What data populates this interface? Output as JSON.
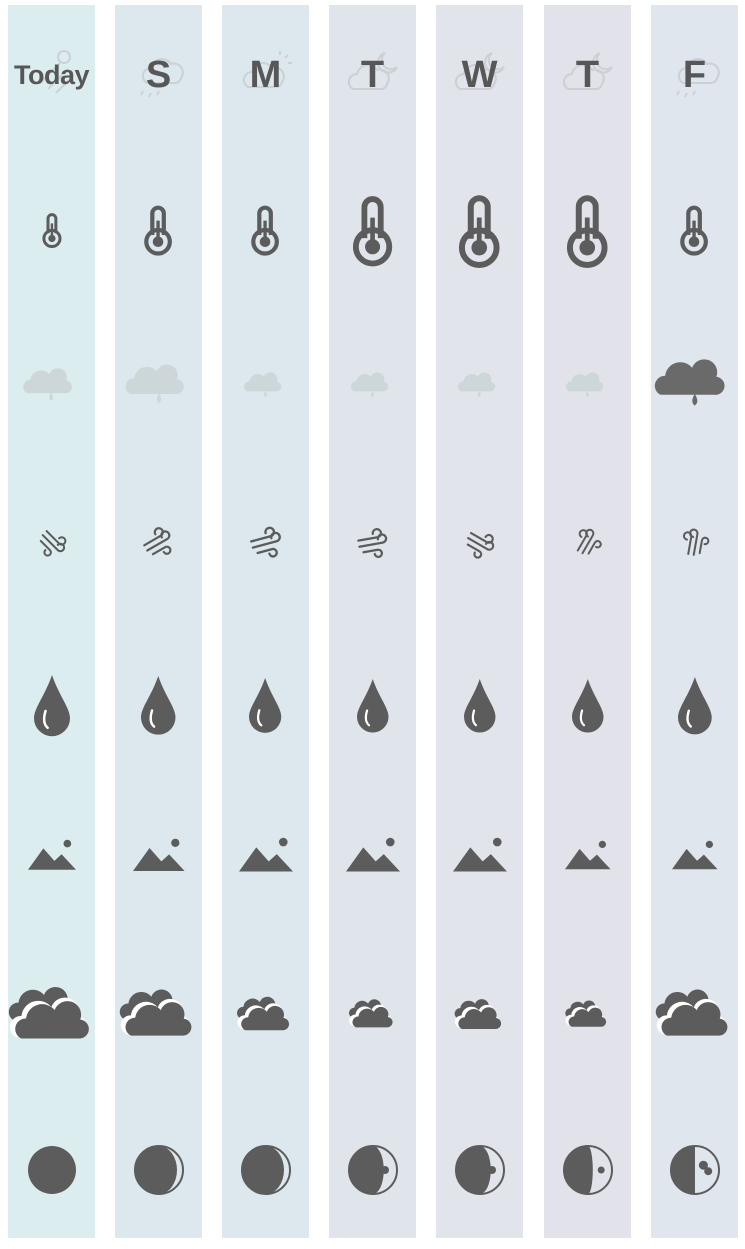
{
  "colors": {
    "icon": "#5c5c5c",
    "rain_faint": "#cdd6d9",
    "rain_dark": "#6a6a6a"
  },
  "days": [
    {
      "label": "Today",
      "bg": "#dcedef",
      "header_icon": "sun-rain-icon",
      "temp": 0.25,
      "rain": 0.55,
      "rain_dark": false,
      "wind": 0.65,
      "wind_dir": 45,
      "humidity": 1.0,
      "visibility": 0.75,
      "clouds": 1.0,
      "moon": "full-moon-icon"
    },
    {
      "label": "S",
      "bg": "#dce8ed",
      "header_icon": "cloud-rain-icon",
      "temp": 0.55,
      "rain": 0.75,
      "rain_dark": false,
      "wind": 0.85,
      "wind_dir": -30,
      "humidity": 0.9,
      "visibility": 0.9,
      "clouds": 0.85,
      "moon": "waning-gibbous-icon"
    },
    {
      "label": "M",
      "bg": "#dce8ed",
      "header_icon": "cloud-sun-icon",
      "temp": 0.55,
      "rain": 0.3,
      "rain_dark": false,
      "wind": 1.0,
      "wind_dir": -15,
      "humidity": 0.75,
      "visibility": 1.0,
      "clouds": 0.5,
      "moon": "waning-gibbous-icon"
    },
    {
      "label": "T",
      "bg": "#e0e4eb",
      "header_icon": "cloud-moon-icon",
      "temp": 0.95,
      "rain": 0.3,
      "rain_dark": false,
      "wind": 0.9,
      "wind_dir": -10,
      "humidity": 0.7,
      "visibility": 1.0,
      "clouds": 0.35,
      "moon": "last-quarter-icon"
    },
    {
      "label": "W",
      "bg": "#e2e4eb",
      "header_icon": "cloud-moon-icon",
      "temp": 1.0,
      "rain": 0.3,
      "rain_dark": false,
      "wind": 0.75,
      "wind_dir": 30,
      "humidity": 0.7,
      "visibility": 1.0,
      "clouds": 0.4,
      "moon": "last-quarter-icon"
    },
    {
      "label": "T",
      "bg": "#e2e3ea",
      "header_icon": "cloud-moon-icon",
      "temp": 1.0,
      "rain": 0.3,
      "rain_dark": false,
      "wind": 0.6,
      "wind_dir": -60,
      "humidity": 0.7,
      "visibility": 0.65,
      "clouds": 0.3,
      "moon": "waning-crescent-icon"
    },
    {
      "label": "F",
      "bg": "#e0e6ed",
      "header_icon": "cloud-rain-icon",
      "temp": 0.55,
      "rain": 1.0,
      "rain_dark": true,
      "wind": 0.65,
      "wind_dir": -80,
      "humidity": 0.85,
      "visibility": 0.65,
      "clouds": 0.85,
      "moon": "first-quarter-icon"
    }
  ]
}
